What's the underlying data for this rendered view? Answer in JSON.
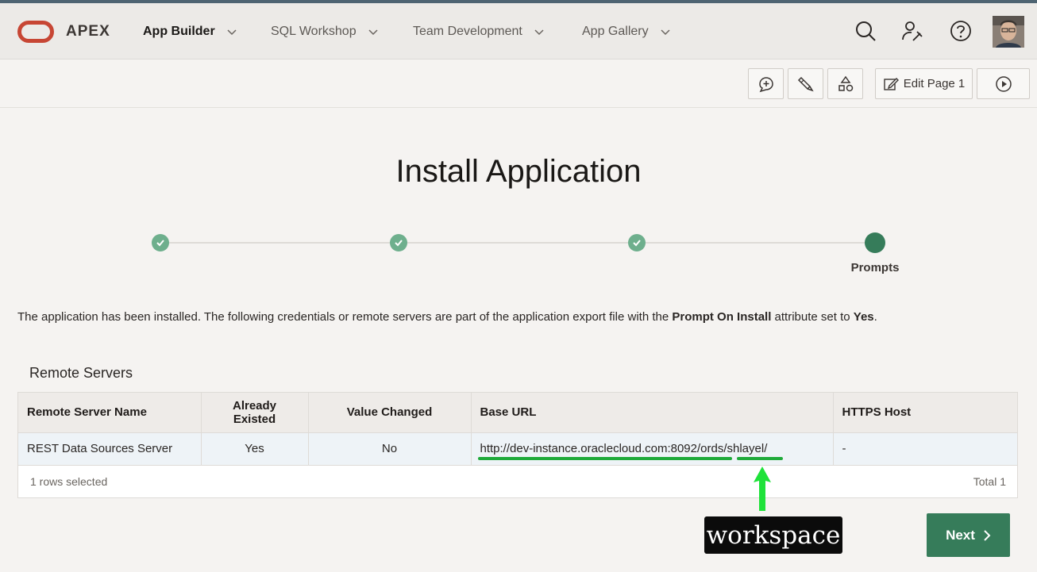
{
  "header": {
    "brand": "APEX",
    "nav": [
      {
        "label": "App Builder"
      },
      {
        "label": "SQL Workshop"
      },
      {
        "label": "Team Development"
      },
      {
        "label": "App Gallery"
      }
    ],
    "icons": [
      "search-icon",
      "admin-tools-icon",
      "help-icon",
      "user-avatar"
    ]
  },
  "toolbar": {
    "edit_page_label": "Edit Page 1",
    "icons": [
      "feedback-icon",
      "quick-sql-icon",
      "shared-components-icon",
      "edit-page-icon",
      "run-page-icon"
    ]
  },
  "page": {
    "title": "Install Application",
    "wizard": {
      "steps_total": 4,
      "completed": 3,
      "current_label": "Prompts"
    },
    "description": {
      "prefix": "The application has been installed. The following credentials or remote servers are part of the application export file with the ",
      "bold1": "Prompt On Install",
      "middle": " attribute set to ",
      "bold2": "Yes",
      "suffix": "."
    }
  },
  "remote_servers": {
    "region_title": "Remote Servers",
    "columns": [
      "Remote Server Name",
      "Already Existed",
      "Value Changed",
      "Base URL",
      "HTTPS Host"
    ],
    "rows": [
      {
        "name": "REST Data Sources Server",
        "already_existed": "Yes",
        "value_changed": "No",
        "base_url": "http://dev-instance.oraclecloud.com:8092/ords/shlayel/",
        "https_host": "-"
      }
    ],
    "footer_left": "1 rows selected",
    "footer_right": "Total 1"
  },
  "annotation": {
    "label": "workspace",
    "color": "#1faa3a"
  },
  "actions": {
    "next_label": "Next"
  },
  "colors": {
    "brand_red": "#c74634",
    "primary_green": "#367c5a",
    "step_done": "#6eaf8d"
  }
}
